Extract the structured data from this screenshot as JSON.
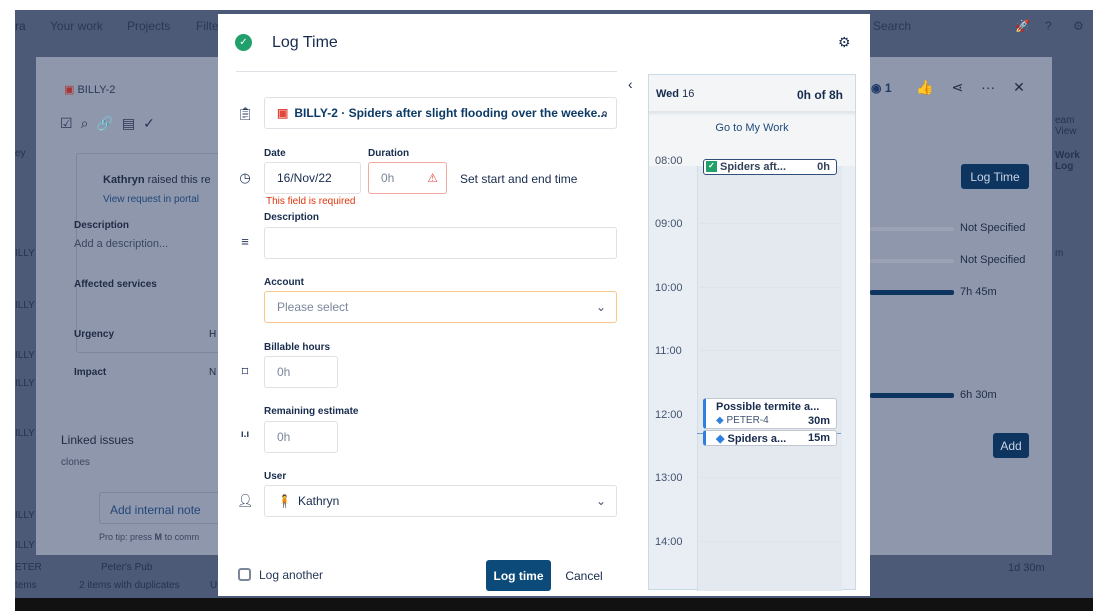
{
  "background": {
    "nav": [
      "Your work",
      "Projects",
      "Filte"
    ],
    "search_placeholder": "Search",
    "issue_key": "BILLY-2",
    "requester": "Kathryn",
    "raised_text": "raised this re",
    "view_request": "View request in portal",
    "description_label": "Description",
    "description_placeholder": "Add a description...",
    "affected_services": "Affected services",
    "urgency": "Urgency",
    "urgency_value": "H",
    "impact": "Impact",
    "impact_value": "N",
    "linked_issues": "Linked issues",
    "clones": "clones",
    "add_internal_note": "Add internal note",
    "pro_tip": "Pro tip: press",
    "pro_tip_key": "M",
    "pro_tip_rest": "to comm",
    "watchers": "1",
    "log_time_button": "Log Time",
    "not_specified_1": "Not Specified",
    "not_specified_2": "Not Specified",
    "time_1": "7h 45m",
    "time_2": "6h 30m",
    "add_button": "Add",
    "team_view": "eam View",
    "work_log": "Work Log",
    "side_rows": [
      "ey",
      "ILLY",
      "ILLY",
      "ILLY",
      "ILLY",
      "ILLY",
      "ILLY",
      "ILLY"
    ],
    "peter_label": "ETER",
    "peters_pub": "Peter's Pub",
    "items": "tems",
    "duplicates": "2 items with duplicates",
    "col_u": "U",
    "right_m": "m",
    "total": "1d 30m"
  },
  "modal": {
    "title": "Log Time",
    "issue_value": "BILLY-2 · Spiders after slight flooding over the weeke...",
    "date_label": "Date",
    "date_value": "16/Nov/22",
    "duration_label": "Duration",
    "duration_placeholder": "0h",
    "set_start_end": "Set start and end time",
    "error": "This field is required",
    "description_label": "Description",
    "account_label": "Account",
    "account_placeholder": "Please select",
    "billable_label": "Billable hours",
    "billable_placeholder": "0h",
    "remaining_label": "Remaining estimate",
    "remaining_placeholder": "0h",
    "user_label": "User",
    "user_value": "Kathryn",
    "log_another": "Log another",
    "log_time": "Log time",
    "cancel": "Cancel"
  },
  "calendar": {
    "day": "Wed",
    "date": "16",
    "summary": "0h of 8h",
    "go_to": "Go to My Work",
    "hours": [
      "08:00",
      "09:00",
      "10:00",
      "11:00",
      "12:00",
      "13:00",
      "14:00"
    ],
    "events": [
      {
        "title": "Spiders aft...",
        "duration": "0h"
      },
      {
        "title": "Possible termite a...",
        "key": "PETER-4",
        "duration": "30m"
      },
      {
        "title": "Spiders a...",
        "duration": "15m"
      }
    ]
  },
  "colors": {
    "primary": "#0c4a7a",
    "success": "#22a06b",
    "error": "#de350b",
    "warning_border": "#f8c78a"
  }
}
